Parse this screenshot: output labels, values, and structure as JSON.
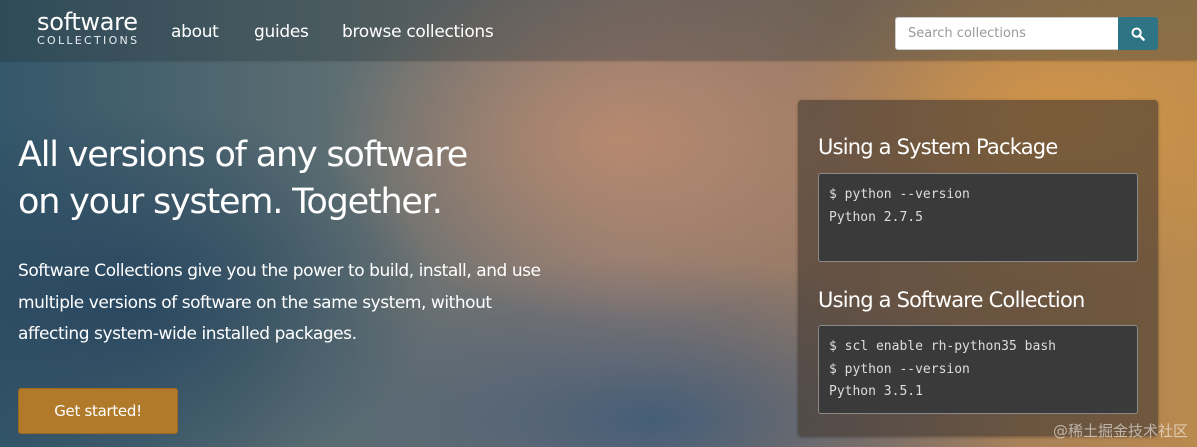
{
  "brand": {
    "line1": "software",
    "line2": "COLLECTIONS"
  },
  "nav": {
    "items": [
      "about",
      "guides",
      "browse collections"
    ]
  },
  "search": {
    "placeholder": "Search collections",
    "value": "",
    "icon": "search-icon"
  },
  "hero": {
    "headline_line1": "All versions of any software",
    "headline_line2": "on your system. Together.",
    "lead_line1": "Software Collections give you the power to build, install, and use",
    "lead_line2": "multiple versions of software on the same system, without",
    "lead_line3": "affecting system-wide installed packages.",
    "cta_label": "Get started!"
  },
  "panel": {
    "section1": {
      "title": "Using a System Package",
      "lines": [
        "$ python --version",
        "Python 2.7.5"
      ]
    },
    "section2": {
      "title": "Using a Software Collection",
      "lines": [
        "$ scl enable rh-python35 bash",
        "$ python --version",
        "Python 3.5.1"
      ]
    }
  },
  "watermark": "@稀土掘金技术社区",
  "colors": {
    "cta": "#b07a2a",
    "search_button": "#2e7485",
    "code_bg": "#3a3a3a"
  }
}
